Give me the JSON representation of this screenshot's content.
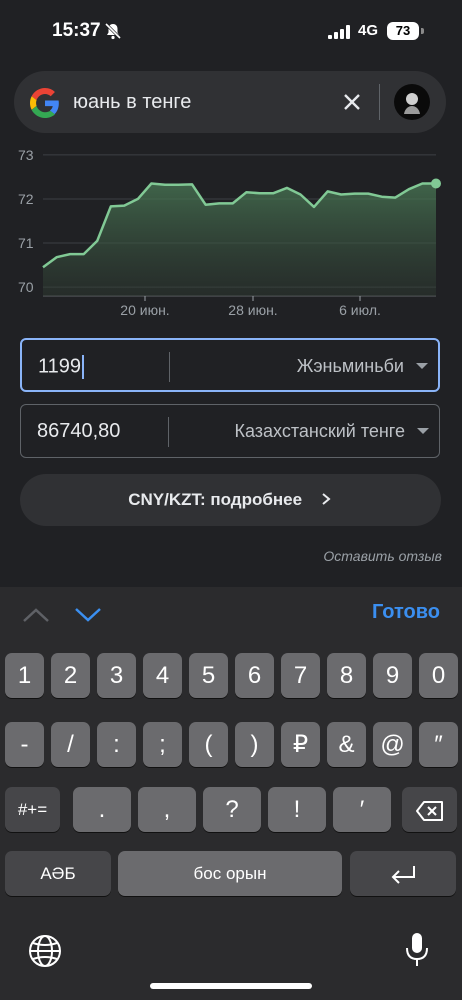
{
  "status": {
    "time": "15:37",
    "network": "4G",
    "battery": "73"
  },
  "search": {
    "query": "юань в тенге"
  },
  "chart_data": {
    "type": "line",
    "x_ticks": [
      "20 июн.",
      "28 июн.",
      "6 июл."
    ],
    "y_ticks": [
      70,
      71,
      72,
      73
    ],
    "ylim": [
      69.8,
      73.2
    ],
    "values": [
      70.45,
      70.68,
      70.75,
      70.75,
      71.05,
      71.83,
      71.85,
      72.0,
      72.35,
      72.32,
      72.32,
      72.33,
      71.87,
      71.9,
      71.9,
      72.15,
      72.13,
      72.13,
      72.25,
      72.1,
      71.82,
      72.17,
      72.1,
      72.12,
      72.12,
      72.05,
      72.03,
      72.22,
      72.35,
      72.35
    ],
    "line_color": "#81c995"
  },
  "converter": {
    "from_value": "1199",
    "from_currency": "Жэньминьби",
    "to_value": "86740,80",
    "to_currency": "Казахстанский тенге"
  },
  "details_button": "CNY/KZT: подробнее",
  "feedback": "Оставить отзыв",
  "keyboard": {
    "done": "Готово",
    "row1": [
      "1",
      "2",
      "3",
      "4",
      "5",
      "6",
      "7",
      "8",
      "9",
      "0"
    ],
    "row2": [
      "-",
      "/",
      ":",
      ";",
      "(",
      ")",
      "₽",
      "&",
      "@",
      "″"
    ],
    "row3_left": "#+=",
    "row3": [
      ".",
      ",",
      "?",
      "!",
      "′"
    ],
    "abc": "АӘБ",
    "space": "бос орын"
  }
}
